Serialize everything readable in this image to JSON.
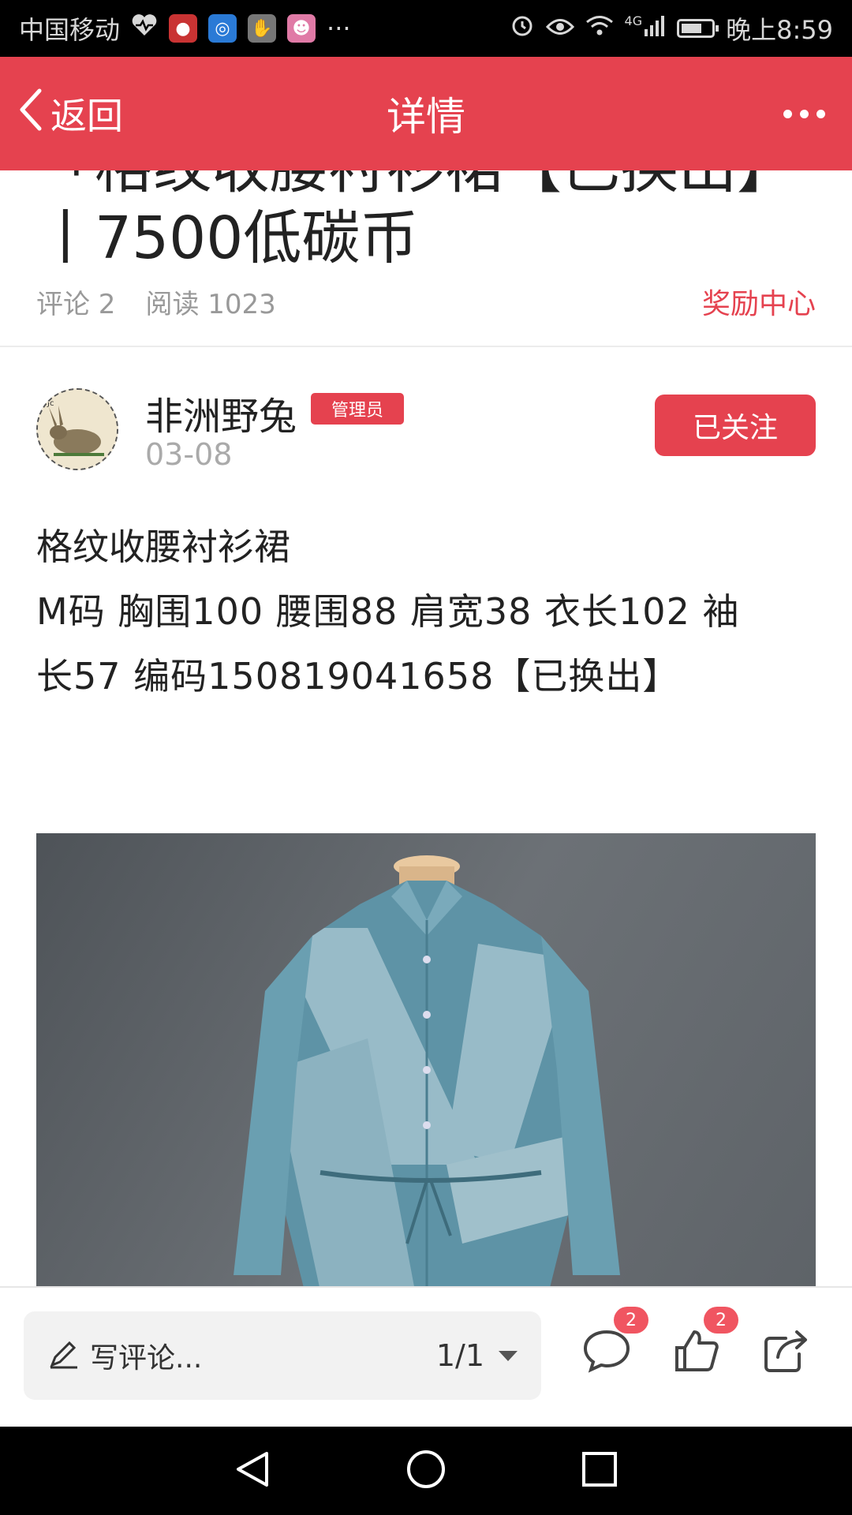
{
  "status_bar": {
    "carrier": "中国移动",
    "more": "···",
    "network": "4G",
    "time": "晚上8:59"
  },
  "nav": {
    "back_label": "返回",
    "title": "详情"
  },
  "article": {
    "title_fragment": "「格纹收腰衬衫裙【已换出】",
    "title_line2": "丨7500低碳币",
    "comments_label": "评论 2",
    "reads_label": "阅读 1023",
    "reward_center": "奖励中心"
  },
  "author": {
    "name": "非洲野兔",
    "badge": "管理员",
    "date": "03-08",
    "follow_label": "已关注"
  },
  "post": {
    "line1": "格纹收腰衬衫裙",
    "line2": "M码  胸围100  腰围88  肩宽38  衣长102  袖",
    "line3": "长57  编码150819041658【已换出】"
  },
  "bottom": {
    "comment_placeholder": "写评论...",
    "page_indicator": "1/1",
    "comment_count": "2",
    "like_count": "2"
  }
}
